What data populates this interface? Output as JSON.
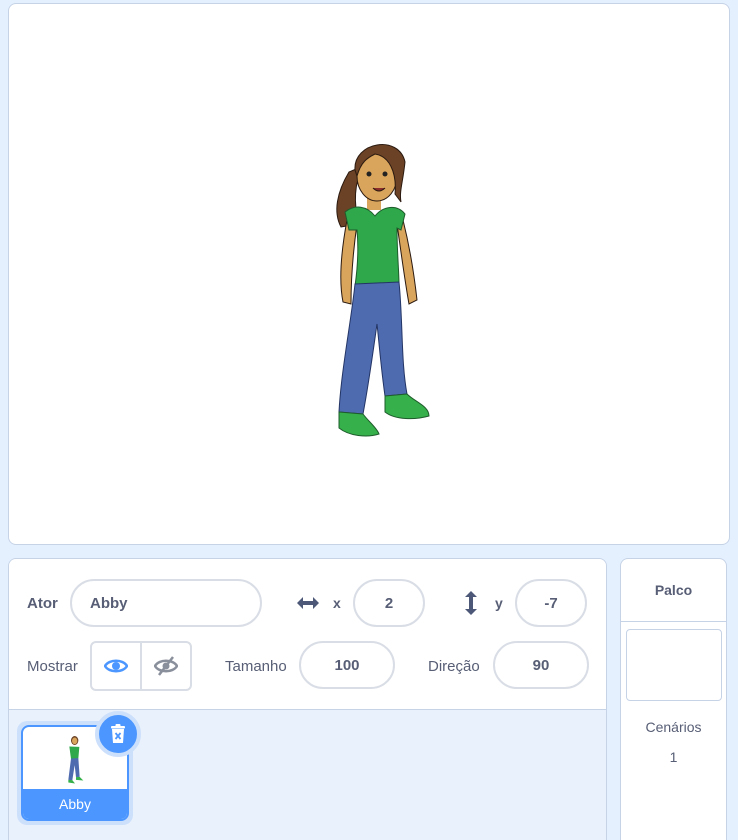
{
  "stage": {
    "sprite_name": "Abby"
  },
  "sprite_info": {
    "sprite_label": "Ator",
    "sprite_name": "Abby",
    "x_label": "x",
    "x_value": "2",
    "y_label": "y",
    "y_value": "-7",
    "show_label": "Mostrar",
    "size_label": "Tamanho",
    "size_value": "100",
    "direction_label": "Direção",
    "direction_value": "90"
  },
  "sprite_list": [
    {
      "name": "Abby",
      "selected": true
    }
  ],
  "stage_selector": {
    "title": "Palco",
    "backdrops_label": "Cenários",
    "backdrops_count": "1"
  },
  "colors": {
    "accent": "#4c97ff",
    "text": "#575e75",
    "panel_bg": "#e9f1fc"
  }
}
